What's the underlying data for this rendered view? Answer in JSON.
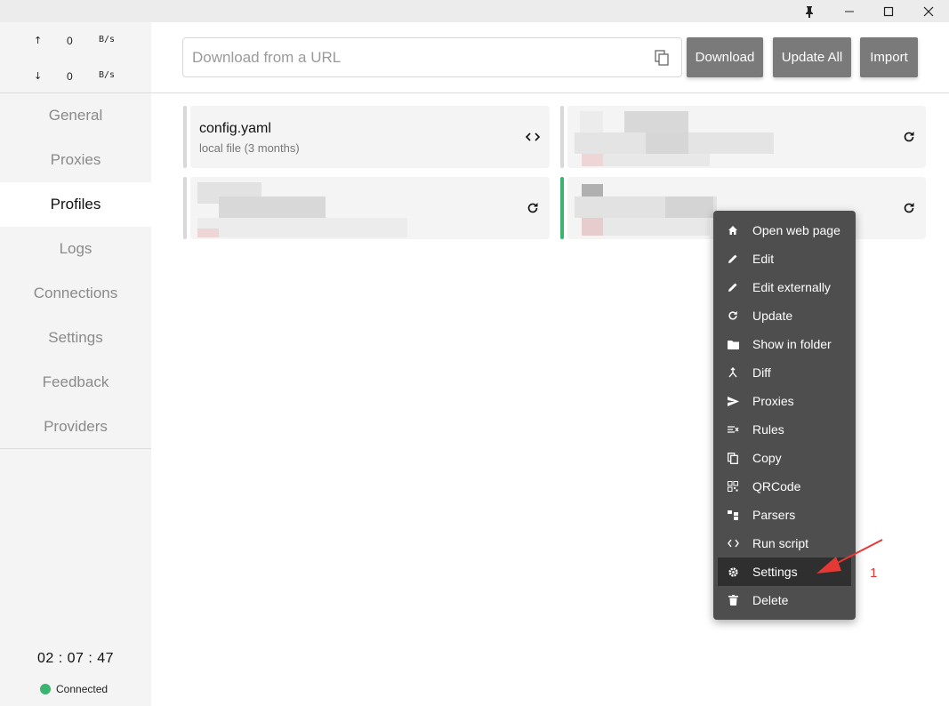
{
  "window_controls": {
    "pin": "pin-icon",
    "minimize": "minimize-icon",
    "maximize": "maximize-icon",
    "close": "close-icon"
  },
  "traffic": {
    "up": {
      "arrow": "↑",
      "value": "0",
      "unit": "B/s"
    },
    "down": {
      "arrow": "↓",
      "value": "0",
      "unit": "B/s"
    }
  },
  "nav": [
    "General",
    "Proxies",
    "Profiles",
    "Logs",
    "Connections",
    "Settings",
    "Feedback",
    "Providers"
  ],
  "active_nav": "Profiles",
  "clock": "02 : 07 : 47",
  "status": "Connected",
  "url_input": {
    "placeholder": "Download from a URL",
    "value": ""
  },
  "buttons": {
    "download": "Download",
    "update_all": "Update All",
    "import": "Import"
  },
  "profiles": [
    {
      "name": "config.yaml",
      "sub": "local file (3 months)",
      "action_icon": "code-icon",
      "selected": false
    },
    {
      "name": "",
      "sub": "",
      "action_icon": "refresh-icon",
      "selected": false,
      "pixelated": true
    },
    {
      "name": "",
      "sub": "",
      "action_icon": "refresh-icon",
      "selected": false,
      "pixelated": true
    },
    {
      "name": "",
      "sub": "",
      "action_icon": "refresh-icon",
      "selected": true,
      "pixelated": true
    }
  ],
  "context_menu": [
    {
      "label": "Open web page",
      "icon": "home-icon"
    },
    {
      "label": "Edit",
      "icon": "pencil-icon"
    },
    {
      "label": "Edit externally",
      "icon": "pencil-icon"
    },
    {
      "label": "Update",
      "icon": "refresh-icon"
    },
    {
      "label": "Show in folder",
      "icon": "folder-icon"
    },
    {
      "label": "Diff",
      "icon": "merge-icon"
    },
    {
      "label": "Proxies",
      "icon": "send-icon"
    },
    {
      "label": "Rules",
      "icon": "rules-icon"
    },
    {
      "label": "Copy",
      "icon": "copy-icon"
    },
    {
      "label": "QRCode",
      "icon": "qrcode-icon"
    },
    {
      "label": "Parsers",
      "icon": "parsers-icon"
    },
    {
      "label": "Run script",
      "icon": "code-icon"
    },
    {
      "label": "Settings",
      "icon": "gear-icon",
      "highlighted": true
    },
    {
      "label": "Delete",
      "icon": "trash-icon"
    }
  ],
  "annotation": {
    "label": "1",
    "color": "#e53935"
  },
  "colors": {
    "accent_green": "#3cb371",
    "button_gray": "#7a7a7a",
    "menu_bg": "#4e4e4e",
    "sidebar_bg": "#f4f4f4"
  }
}
